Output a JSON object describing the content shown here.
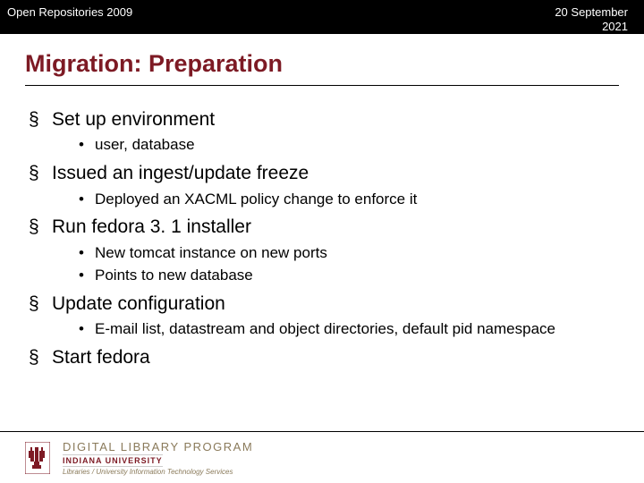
{
  "header": {
    "left": "Open Repositories 2009",
    "right": "20 September 2021"
  },
  "title": "Migration: Preparation",
  "bullets": [
    {
      "text": "Set up environment",
      "sub": [
        "user, database"
      ]
    },
    {
      "text": "Issued an ingest/update freeze",
      "sub": [
        "Deployed an XACML policy change to enforce it"
      ]
    },
    {
      "text": "Run fedora 3. 1 installer",
      "sub": [
        "New tomcat instance on new ports",
        "Points to new database"
      ]
    },
    {
      "text": "Update configuration",
      "sub": [
        "E-mail list, datastream and object directories, default pid namespace"
      ]
    },
    {
      "text": "Start fedora",
      "sub": []
    }
  ],
  "footer": {
    "program": "DIGITAL LIBRARY PROGRAM",
    "university": "INDIANA UNIVERSITY",
    "tagline": "Libraries / University Information Technology Services"
  }
}
